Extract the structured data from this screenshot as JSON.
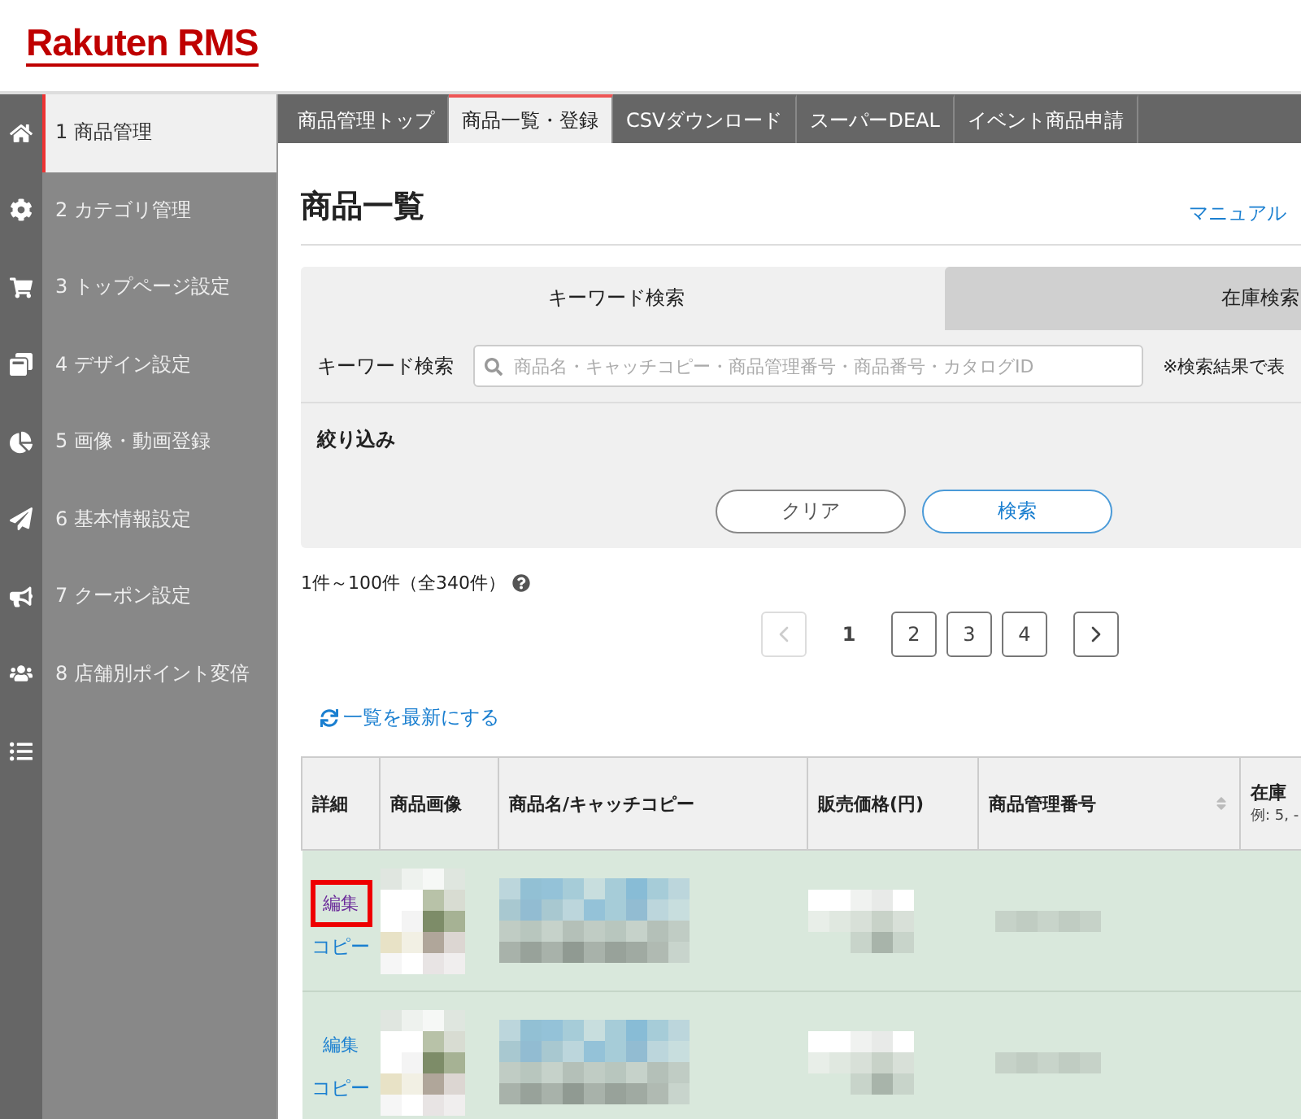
{
  "logo": "Rakuten RMS",
  "sidebar": {
    "items": [
      {
        "kind": "home",
        "label": "1 商品管理",
        "selected": true
      },
      {
        "kind": "gear",
        "label": "2 カテゴリ管理",
        "selected": false
      },
      {
        "kind": "cart",
        "label": "3 トップページ設定",
        "selected": false
      },
      {
        "kind": "windows",
        "label": "4 デザイン設定",
        "selected": false
      },
      {
        "kind": "pie",
        "label": "5 画像・動画登録",
        "selected": false
      },
      {
        "kind": "plane",
        "label": "6 基本情報設定",
        "selected": false
      },
      {
        "kind": "megaphone",
        "label": "7 クーポン設定",
        "selected": false
      },
      {
        "kind": "people",
        "label": "8 店舗別ポイント変倍",
        "selected": false
      },
      {
        "kind": "list",
        "selected": false
      }
    ]
  },
  "tabs": [
    {
      "label": "商品管理トップ",
      "selected": false
    },
    {
      "label": "商品一覧・登録",
      "selected": true
    },
    {
      "label": "CSVダウンロード",
      "selected": false
    },
    {
      "label": "スーパーDEAL",
      "selected": false
    },
    {
      "label": "イベント商品申請",
      "selected": false
    }
  ],
  "page_title": "商品一覧",
  "manual_link": "マニュアル",
  "search_tabs": [
    {
      "label": "キーワード検索",
      "selected": true
    },
    {
      "label": "在庫検索",
      "selected": false
    }
  ],
  "keyword": {
    "label": "キーワード検索",
    "placeholder": "商品名・キャッチコピー・商品管理番号・商品番号・カタログID",
    "note": "※検索結果で表"
  },
  "filter_label": "絞り込み",
  "buttons": [
    {
      "label": "クリア",
      "kind": "secondary"
    },
    {
      "label": "検索",
      "kind": "primary"
    }
  ],
  "count": "1件～100件（全340件）",
  "pagination": {
    "prev_disabled": true,
    "pages": [
      {
        "label": "1",
        "selected": true
      },
      {
        "label": "2",
        "selected": false
      },
      {
        "label": "3",
        "selected": false
      },
      {
        "label": "4",
        "selected": false
      }
    ]
  },
  "refresh_link": "一覧を最新にする",
  "table": {
    "columns": [
      {
        "label": "詳細"
      },
      {
        "label": "商品画像"
      },
      {
        "label": "商品名/キャッチコピー"
      },
      {
        "label": "販売価格(円)"
      },
      {
        "label": "商品管理番号",
        "sortable": true
      },
      {
        "label": "在庫",
        "hint": "例: 5, -"
      }
    ],
    "rows": [
      {
        "edit": "編集",
        "copy": "コピー",
        "highlighted": true
      },
      {
        "edit": "編集",
        "copy": "コピー",
        "highlighted": false
      }
    ]
  }
}
